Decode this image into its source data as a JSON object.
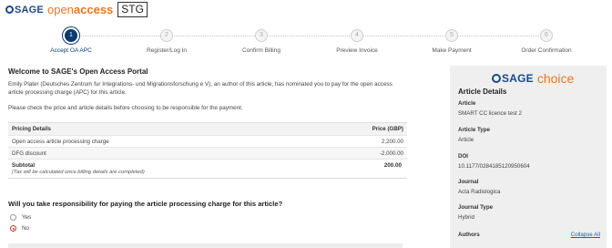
{
  "brand": {
    "sage": "SAGE",
    "open": "open",
    "access": "access",
    "env_badge": "STG",
    "choice": "choice"
  },
  "colors": {
    "accent": "#e87722",
    "primary": "#0b3a6e",
    "link": "#1a5fb4"
  },
  "steps": [
    {
      "num": "1",
      "label": "Accept OA APC",
      "active": true
    },
    {
      "num": "2",
      "label": "Register/Log In",
      "active": false
    },
    {
      "num": "3",
      "label": "Confirm Billing",
      "active": false
    },
    {
      "num": "4",
      "label": "Preview Invoice",
      "active": false
    },
    {
      "num": "5",
      "label": "Make Payment",
      "active": false
    },
    {
      "num": "6",
      "label": "Order Confirmation",
      "active": false
    }
  ],
  "main": {
    "welcome": "Welcome to SAGE's Open Access Portal",
    "intro": "Emily Plater (Deutsches Zentrum fur Integrations- und Migrationsforschung e V), an author of this article, has nominated you to pay for the open access article processing charge (APC) for this article.",
    "check": "Please check the price and article details before choosing to be responsible for the payment."
  },
  "pricing": {
    "col_details": "Pricing Details",
    "col_price": "Price (GBP)",
    "rows": [
      {
        "label": "Open access article processing charge",
        "value": "2,200.00"
      },
      {
        "label": "DFG discount",
        "value": "-2,000.00"
      }
    ],
    "subtotal_label": "Subtotal",
    "subtotal_note": "(Tax will be calculated once billing details are completed)",
    "subtotal_value": "200.00"
  },
  "question": {
    "text": "Will you take responsibility for paying the article processing charge for this article?",
    "options": [
      {
        "label": "Yes",
        "selected": false
      },
      {
        "label": "No",
        "selected": true
      }
    ]
  },
  "sidebar": {
    "title": "Article Details",
    "article_label": "Article",
    "article_value": "SMART CC licence test 2",
    "type_label": "Article Type",
    "type_value": "Article",
    "doi_label": "DOI",
    "doi_value": "10.1177/0284185120950604",
    "journal_label": "Journal",
    "journal_value": "Acta Radiologica",
    "journal_type_label": "Journal Type",
    "journal_type_value": "Hybrid",
    "authors_label": "Authors",
    "collapse_label": "Collapse All"
  }
}
